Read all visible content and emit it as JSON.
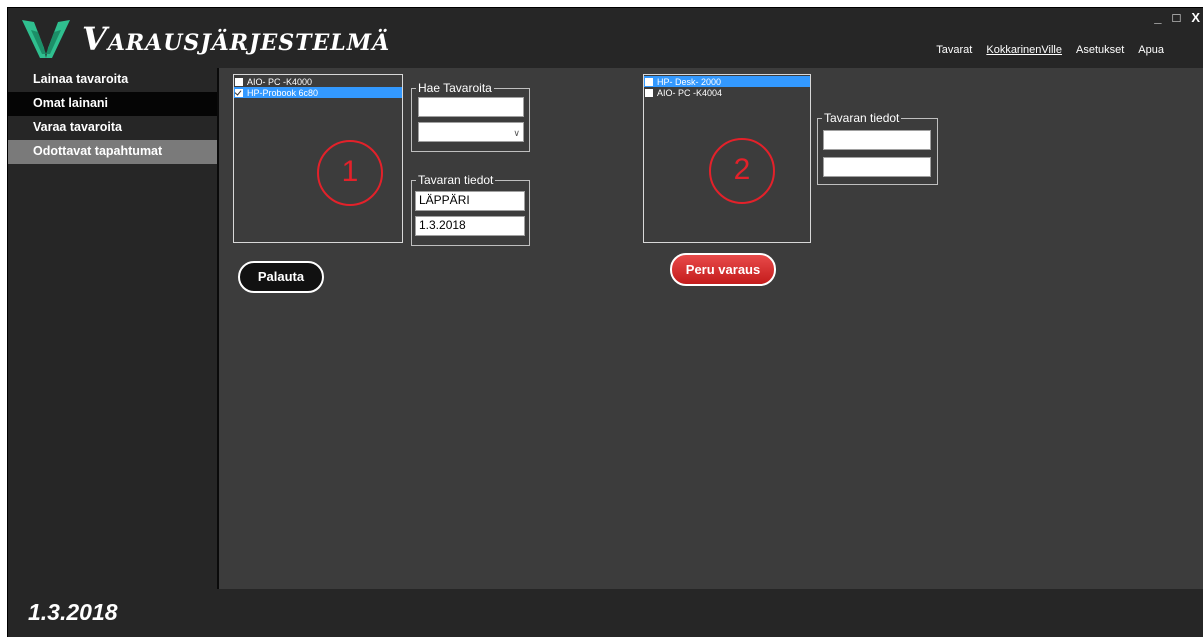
{
  "app": {
    "title": "Varausjärjestelmä",
    "nav": [
      "Tavarat",
      "KokkarinenVille",
      "Asetukset",
      "Apua"
    ],
    "window_controls": {
      "minimize": "_",
      "maximize": "□",
      "close": "X"
    }
  },
  "sidebar": {
    "items": [
      {
        "label": "Lainaa tavaroita"
      },
      {
        "label": "Omat lainani"
      },
      {
        "label": "Varaa tavaroita"
      },
      {
        "label": "Odottavat tapahtumat"
      }
    ]
  },
  "panel1": {
    "items": [
      {
        "label": "AIO- PC -K4000",
        "checked": false,
        "selected": false
      },
      {
        "label": "HP-Probook 6c80",
        "checked": true,
        "selected": true
      }
    ],
    "search_group": {
      "label": "Hae Tavaroita",
      "search_value": "",
      "combo_value": ""
    },
    "details_group": {
      "label": "Tavaran tiedot",
      "type_value": "LÄPPÄRI",
      "date_value": "1.3.2018"
    },
    "return_button": "Palauta",
    "annotation": "1"
  },
  "panel2": {
    "items": [
      {
        "label": "HP- Desk- 2000",
        "checked": false,
        "selected": true
      },
      {
        "label": "AIO- PC -K4004",
        "checked": false,
        "selected": false
      }
    ],
    "details_group": {
      "label": "Tavaran tiedot",
      "type_value": "",
      "date_value": ""
    },
    "cancel_button": "Peru varaus",
    "annotation": "2"
  },
  "footer": {
    "date": "1.3.2018"
  },
  "colors": {
    "background": "#3c3c3c",
    "chrome": "#262626",
    "selection": "#3399ff",
    "annotation": "#e3212a",
    "cancel_button": "#d42a2a",
    "logo": "#2fbf8f"
  },
  "icons": {
    "logo": "v-leaf-logo-icon",
    "combo": "chevron-down-icon"
  }
}
